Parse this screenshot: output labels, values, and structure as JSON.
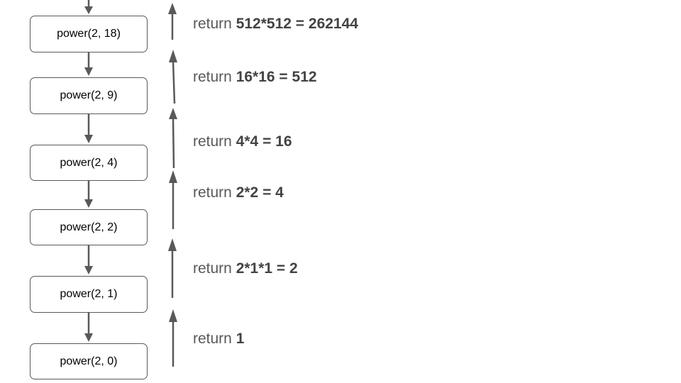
{
  "colors": {
    "arrow": "#595959",
    "box_border": "#595959",
    "text": "#000000",
    "return_text": "#595959"
  },
  "calls": [
    {
      "label": "power(2, 18)"
    },
    {
      "label": "power(2, 9)"
    },
    {
      "label": "power(2, 4)"
    },
    {
      "label": "power(2, 2)"
    },
    {
      "label": "power(2, 1)"
    },
    {
      "label": "power(2, 0)"
    }
  ],
  "returns": [
    {
      "prefix": "return",
      "value": "512*512 = 262144"
    },
    {
      "prefix": "return",
      "value": "16*16 = 512"
    },
    {
      "prefix": "return",
      "value": "4*4 = 16"
    },
    {
      "prefix": "return",
      "value": "2*2 = 4"
    },
    {
      "prefix": "return",
      "value": "2*1*1 = 2"
    },
    {
      "prefix": "return",
      "value": "1"
    }
  ]
}
